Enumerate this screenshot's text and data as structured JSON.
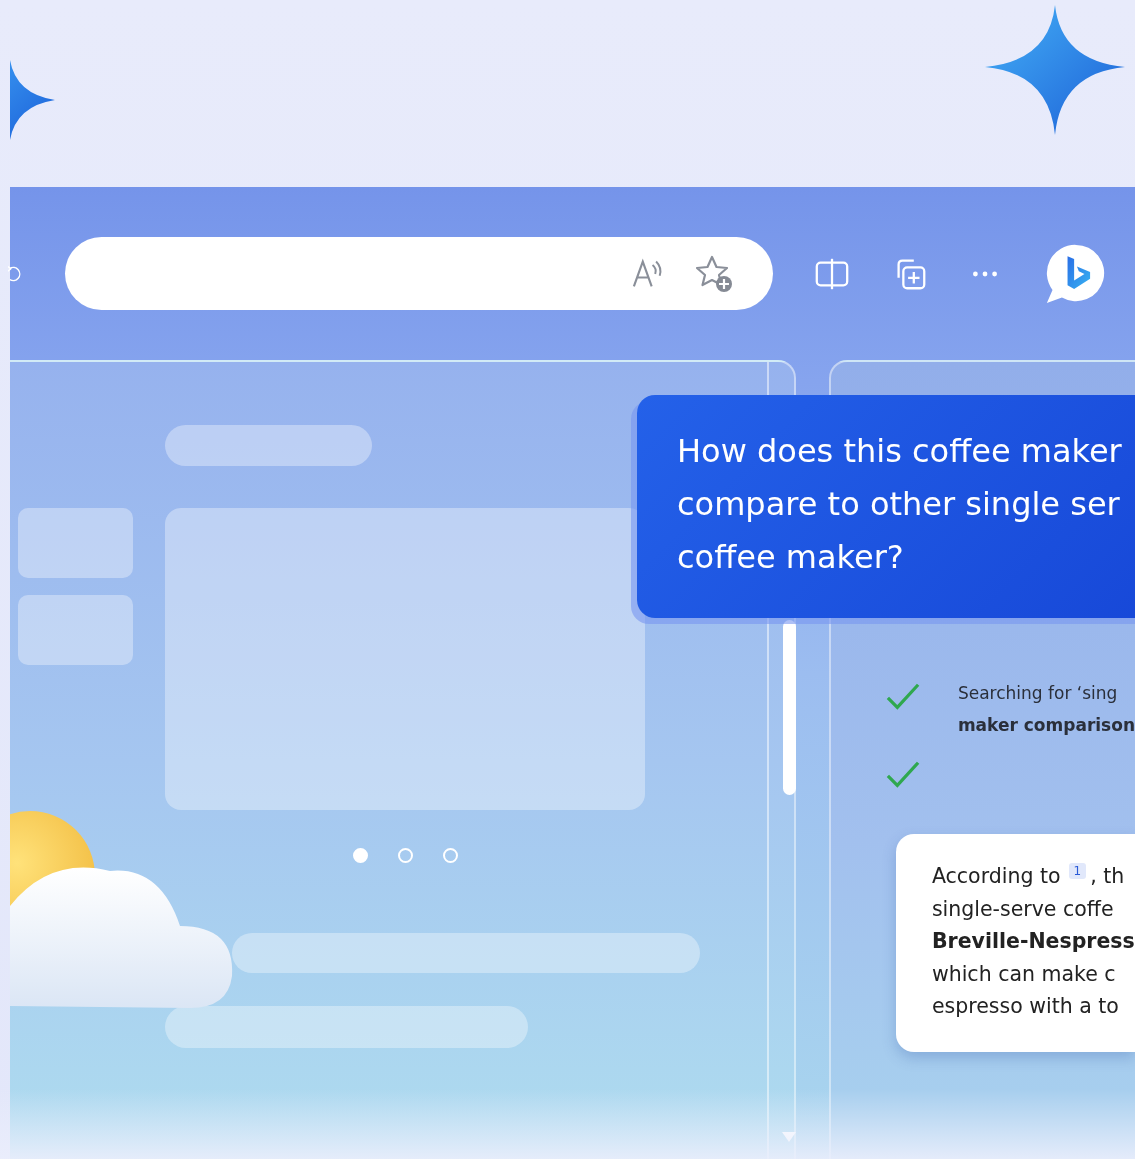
{
  "carousel": [
    {
      "selected": true
    },
    {
      "selected": false
    },
    {
      "selected": false
    }
  ],
  "prompt": {
    "lines": [
      "How does this coffee maker",
      "compare to other single ser",
      "coffee maker?"
    ]
  },
  "steps": [
    {
      "done": true,
      "lines": [
        "Searching for ‘sing",
        "maker comparison"
      ]
    },
    {
      "done": true
    }
  ],
  "answer": {
    "lead": "According to",
    "citation": "1",
    "lead_rest": ", th",
    "lines": [
      {
        "text": "single-serve coffe",
        "bold": false
      },
      {
        "text": "Breville-Nespress",
        "bold": true
      },
      {
        "text": "which can make c",
        "bold": false
      },
      {
        "text": "espresso with a to",
        "bold": false
      }
    ]
  }
}
